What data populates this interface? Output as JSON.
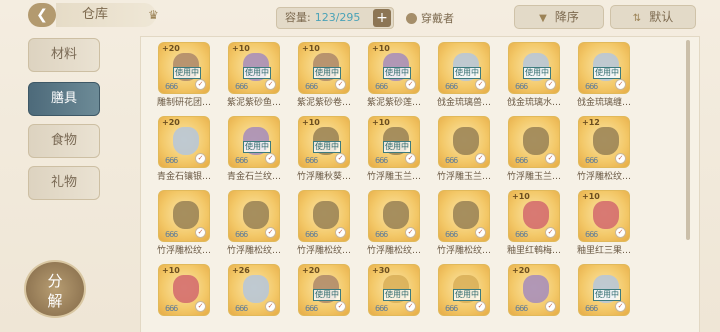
{
  "header": {
    "title": "仓库",
    "capacity_label": "容量:",
    "capacity_value": "123/295",
    "add_label": "+",
    "wearer_label": "穿戴者",
    "sort_desc_label": "降序",
    "sort_default_label": "默认"
  },
  "tabs": [
    {
      "label": "材料",
      "active": false
    },
    {
      "label": "膳具",
      "active": true
    },
    {
      "label": "食物",
      "active": false
    },
    {
      "label": "礼物",
      "active": false
    }
  ],
  "decompose_label_1": "分",
  "decompose_label_2": "解",
  "items": [
    {
      "name": "雕制研花团…",
      "plus": "+20",
      "equipped": true,
      "art": "cat-craft"
    },
    {
      "name": "紫泥紫砂鱼…",
      "plus": "+10",
      "equipped": true,
      "art": "cat-fan"
    },
    {
      "name": "紫泥紫砂卷…",
      "plus": "+10",
      "equipped": true,
      "art": "cat-craft"
    },
    {
      "name": "紫泥紫砂莲…",
      "plus": "+10",
      "equipped": true,
      "art": "cat-fan"
    },
    {
      "name": "戗金琉璃兽…",
      "plus": "",
      "equipped": true,
      "art": "cat-vase"
    },
    {
      "name": "戗金琉璃水…",
      "plus": "",
      "equipped": true,
      "art": "cat-vase"
    },
    {
      "name": "戗金琉璃缠…",
      "plus": "",
      "equipped": true,
      "art": "cat-vase"
    },
    {
      "name": "青金石镶银…",
      "plus": "+20",
      "equipped": false,
      "art": "cat-vase"
    },
    {
      "name": "青金石兰纹…",
      "plus": "",
      "equipped": true,
      "art": "cat-fan"
    },
    {
      "name": "竹浮雕秋葵…",
      "plus": "+10",
      "equipped": true,
      "art": "cat-bamboo"
    },
    {
      "name": "竹浮雕玉兰…",
      "plus": "+10",
      "equipped": true,
      "art": "cat-bamboo"
    },
    {
      "name": "竹浮雕玉兰…",
      "plus": "",
      "equipped": false,
      "art": "cat-bamboo"
    },
    {
      "name": "竹浮雕玉兰…",
      "plus": "",
      "equipped": false,
      "art": "cat-bamboo"
    },
    {
      "name": "竹浮雕松纹…",
      "plus": "+12",
      "equipped": false,
      "art": "cat-bamboo"
    },
    {
      "name": "竹浮雕松纹…",
      "plus": "",
      "equipped": false,
      "art": "cat-bamboo"
    },
    {
      "name": "竹浮雕松纹…",
      "plus": "",
      "equipped": false,
      "art": "cat-bamboo"
    },
    {
      "name": "竹浮雕松纹…",
      "plus": "",
      "equipped": false,
      "art": "cat-bamboo"
    },
    {
      "name": "竹浮雕松纹…",
      "plus": "",
      "equipped": false,
      "art": "cat-bamboo"
    },
    {
      "name": "竹浮雕松纹…",
      "plus": "",
      "equipped": false,
      "art": "cat-bamboo"
    },
    {
      "name": "釉里红鹌梅…",
      "plus": "+10",
      "equipped": false,
      "art": "cat-red"
    },
    {
      "name": "釉里红三果…",
      "plus": "+10",
      "equipped": false,
      "art": "cat-red"
    },
    {
      "name": "",
      "plus": "+10",
      "equipped": false,
      "art": "cat-red"
    },
    {
      "name": "",
      "plus": "+26",
      "equipped": false,
      "art": "cat-vase"
    },
    {
      "name": "",
      "plus": "+20",
      "equipped": true,
      "art": "cat-craft"
    },
    {
      "name": "",
      "plus": "+30",
      "equipped": true,
      "art": "cat-bowl"
    },
    {
      "name": "",
      "plus": "",
      "equipped": true,
      "art": "cat-bowl"
    },
    {
      "name": "",
      "plus": "+20",
      "equipped": false,
      "art": "cat-fan"
    },
    {
      "name": "",
      "plus": "",
      "equipped": true,
      "art": "cat-vase"
    }
  ],
  "equipped_label": "使用中",
  "stars_label": "666"
}
